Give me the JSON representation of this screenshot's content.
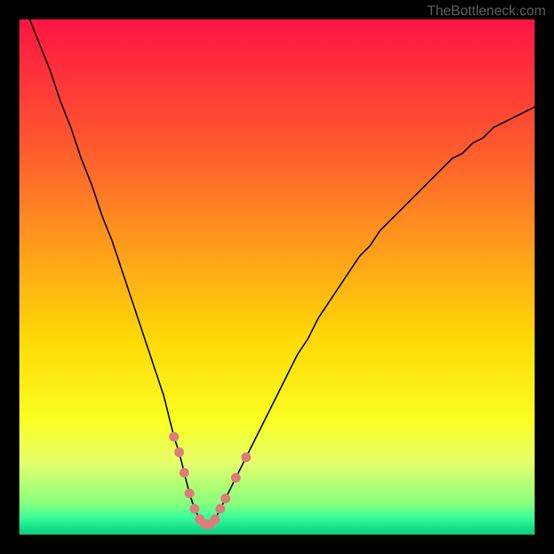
{
  "watermark": "TheBottleneck.com",
  "chart_data": {
    "type": "line",
    "title": "",
    "xlabel": "",
    "ylabel": "",
    "xlim": [
      0,
      100
    ],
    "ylim": [
      0,
      100
    ],
    "x": [
      0,
      2,
      4,
      6,
      8,
      10,
      12,
      14,
      16,
      18,
      20,
      22,
      24,
      26,
      28,
      30,
      31,
      32,
      33,
      34,
      35,
      36,
      37,
      38,
      39,
      40,
      42,
      44,
      46,
      48,
      50,
      52,
      54,
      56,
      58,
      60,
      62,
      64,
      66,
      68,
      70,
      72,
      74,
      76,
      78,
      80,
      82,
      84,
      86,
      88,
      90,
      92,
      94,
      96,
      98,
      100
    ],
    "y": [
      null,
      100,
      95,
      90,
      84,
      79,
      73,
      68,
      62,
      57,
      51,
      45,
      39,
      33,
      27,
      19,
      16,
      12,
      8,
      5,
      3,
      2,
      2,
      3,
      5,
      7,
      11,
      15,
      19,
      23,
      27,
      31,
      35,
      38,
      42,
      45,
      48,
      51,
      54,
      56,
      59,
      61,
      63,
      65,
      67,
      69,
      71,
      73,
      74,
      76,
      77,
      79,
      80,
      81,
      82,
      83
    ],
    "annotations": {
      "markers_near_minimum": [
        {
          "x": 30,
          "y": 19
        },
        {
          "x": 31,
          "y": 16
        },
        {
          "x": 32,
          "y": 12
        },
        {
          "x": 33,
          "y": 8
        },
        {
          "x": 34,
          "y": 5
        },
        {
          "x": 35,
          "y": 3
        },
        {
          "x": 36,
          "y": 2
        },
        {
          "x": 37,
          "y": 2
        },
        {
          "x": 38,
          "y": 3
        },
        {
          "x": 39,
          "y": 5
        },
        {
          "x": 40,
          "y": 7
        },
        {
          "x": 42,
          "y": 11
        },
        {
          "x": 44,
          "y": 15
        }
      ]
    },
    "background_gradient": {
      "type": "vertical",
      "stops": [
        {
          "pos": 0.0,
          "color": "#ff1444"
        },
        {
          "pos": 0.25,
          "color": "#ff5a2e"
        },
        {
          "pos": 0.45,
          "color": "#ff9f1a"
        },
        {
          "pos": 0.62,
          "color": "#ffd905"
        },
        {
          "pos": 0.78,
          "color": "#f9ff22"
        },
        {
          "pos": 0.86,
          "color": "#e5ff6a"
        },
        {
          "pos": 0.94,
          "color": "#88ff7d"
        },
        {
          "pos": 0.965,
          "color": "#3fff9a"
        },
        {
          "pos": 0.985,
          "color": "#17e38a"
        },
        {
          "pos": 1.0,
          "color": "#0ecf7f"
        }
      ]
    }
  }
}
